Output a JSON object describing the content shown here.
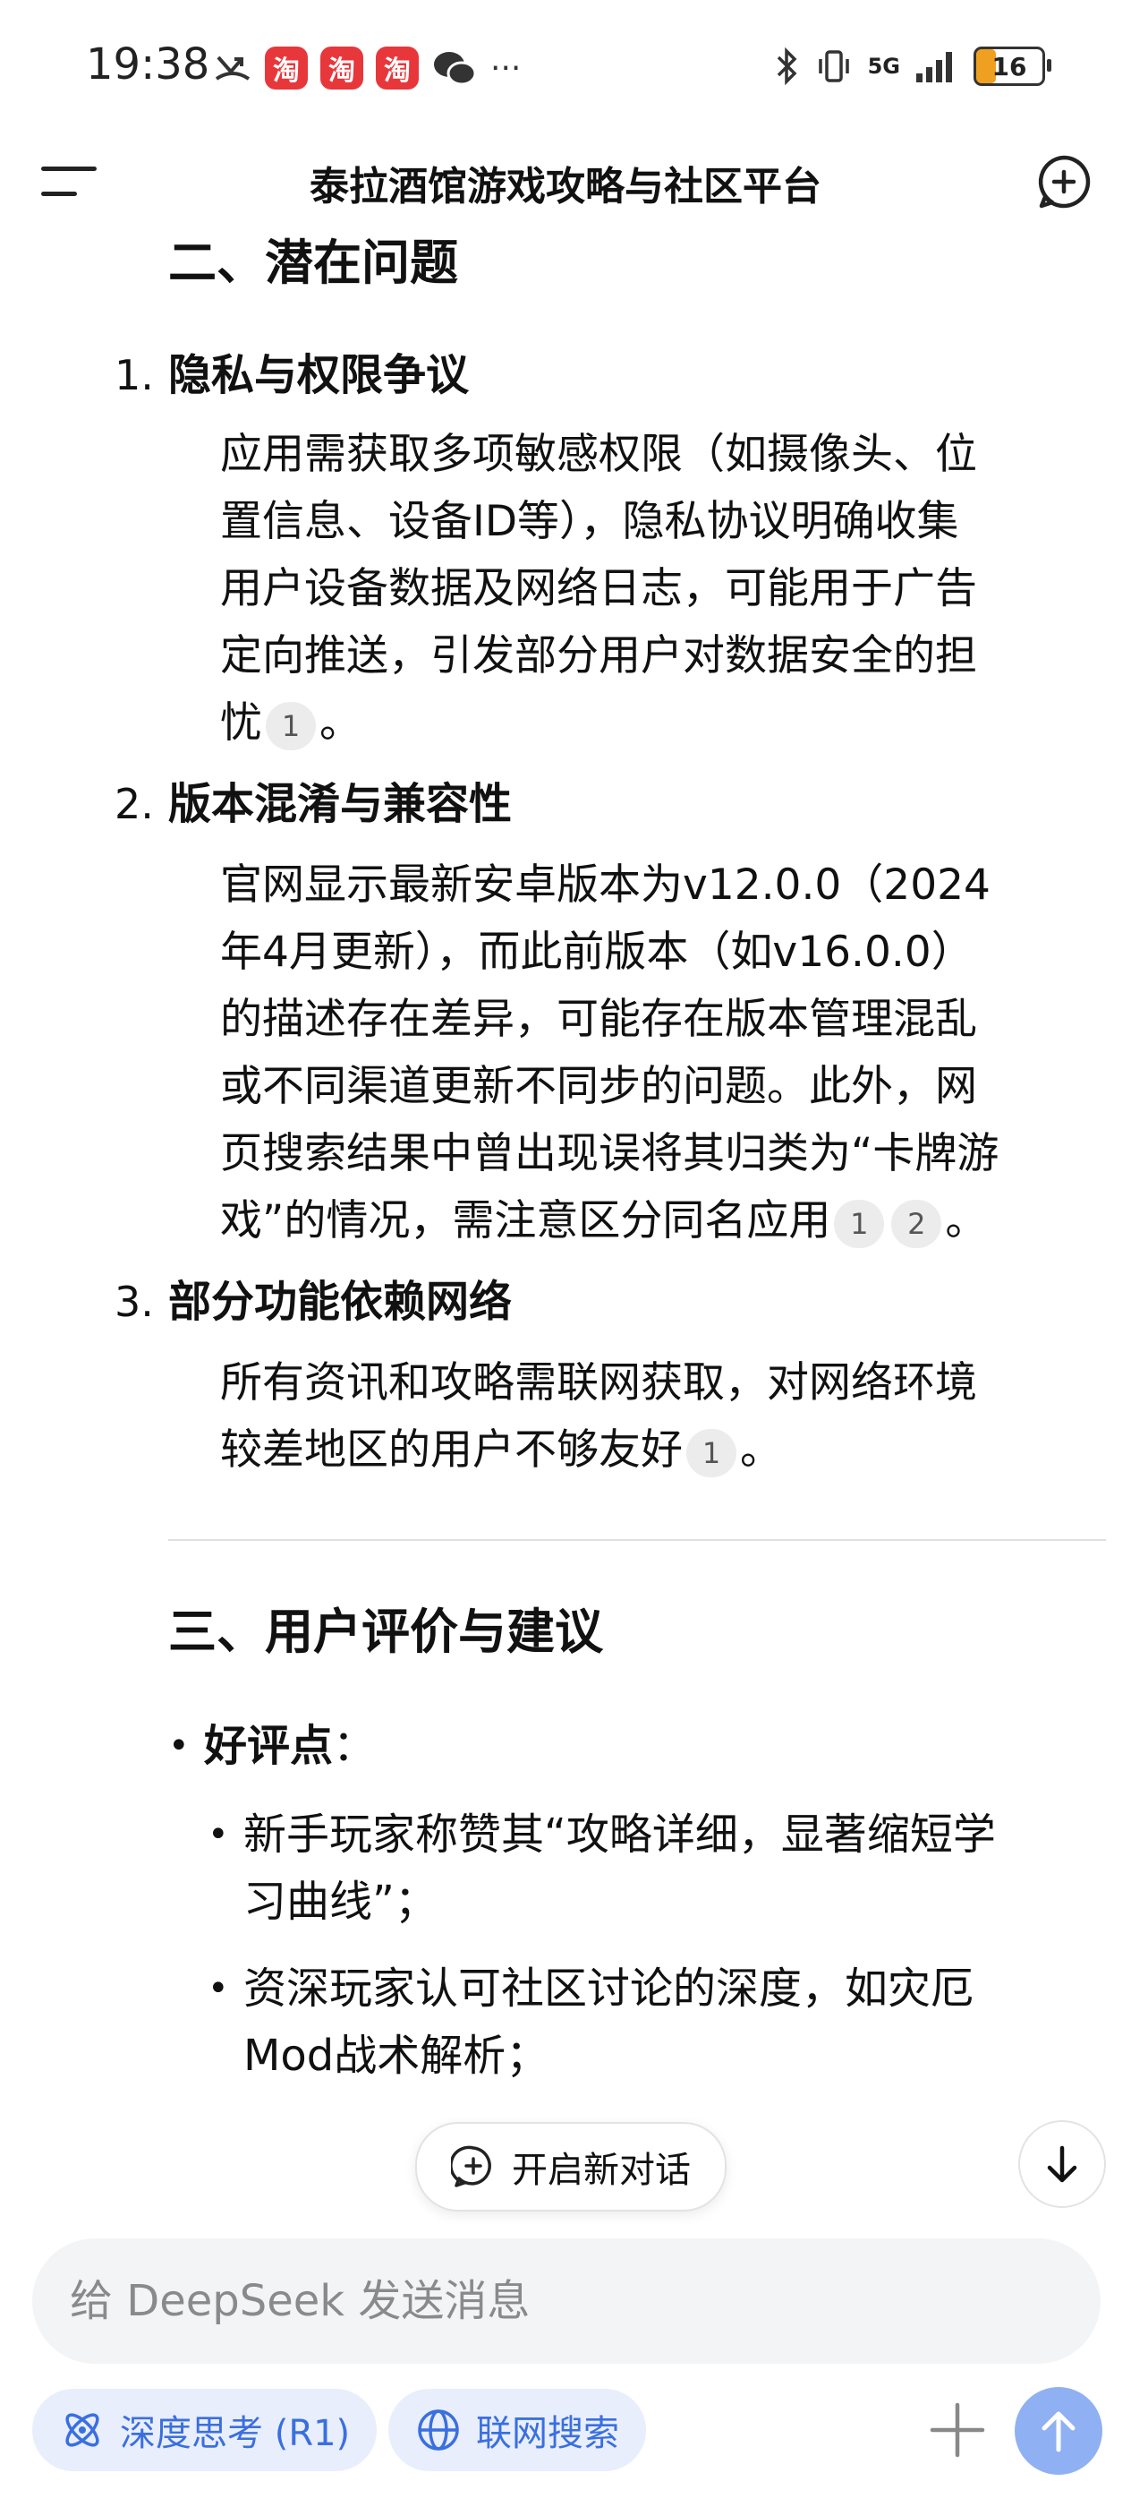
{
  "status_bar": {
    "time": "19:38",
    "battery": "16",
    "network": "5G"
  },
  "header": {
    "title": "泰拉酒馆游戏攻略与社区平台"
  },
  "section2": {
    "heading": "二、潜在问题",
    "items": [
      {
        "num": "1.",
        "title": "隐私与权限争议",
        "text_lines": [
          "应用需获取多项敏感权限（如摄像头、位",
          "置信息、设备ID等），隐私协议明确收集",
          "用户设备数据及网络日志，可能用于广告",
          "定向推送，引发部分用户对数据安全的担"
        ],
        "last": "忧",
        "cites": [
          "1"
        ],
        "end": "。"
      },
      {
        "num": "2.",
        "title": "版本混淆与兼容性",
        "text_lines": [
          "官网显示最新安卓版本为v12.0.0（2024",
          "年4月更新），而此前版本（如v16.0.0）",
          "的描述存在差异，可能存在版本管理混乱",
          "或不同渠道更新不同步的问题。此外，网",
          "页搜索结果中曾出现误将其归类为“卡牌游"
        ],
        "last": "戏”的情况，需注意区分同名应用",
        "cites": [
          "1",
          "2"
        ],
        "end": "。"
      },
      {
        "num": "3.",
        "title": "部分功能依赖网络",
        "text_lines": [
          "所有资讯和攻略需联网获取，对网络环境"
        ],
        "last": "较差地区的用户不够友好",
        "cites": [
          "1"
        ],
        "end": "。"
      }
    ]
  },
  "section3": {
    "heading": "三、用户评价与建议",
    "good_label": "好评点",
    "good_colon": "：",
    "sub1_lines": [
      "新手玩家称赞其“攻略详细，显著缩短学",
      "习曲线”；"
    ],
    "sub2_lines": [
      "资深玩家认可社区讨论的深度，如灾厄",
      "Mod战术解析；"
    ]
  },
  "controls": {
    "new_chat": "开启新对话",
    "input_placeholder": "给 DeepSeek 发送消息",
    "deep_think": "深度思考 (R1)",
    "web_search": "联网搜索"
  },
  "colors": {
    "accent": "#3a6fe0",
    "send_button": "#8fb0f2",
    "pill_bg": "#e8eefc"
  }
}
